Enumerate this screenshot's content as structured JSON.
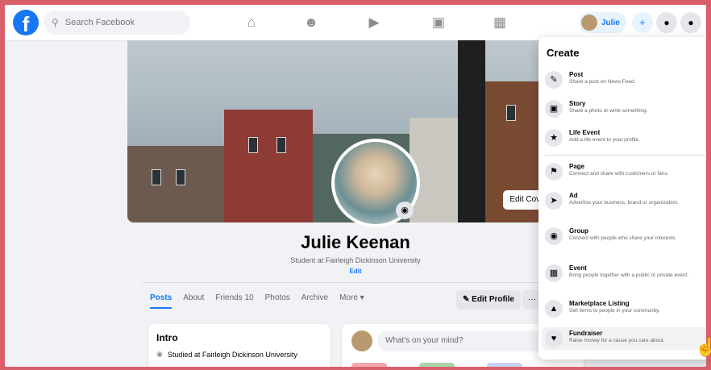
{
  "nav": {
    "search_placeholder": "Search Facebook",
    "profile_name": "Julie"
  },
  "cover": {
    "edit_label": "Edit Cover Photo"
  },
  "profile": {
    "name": "Julie Keenan",
    "bio": "Student at Fairleigh Dickinson University",
    "bio_edit": "Edit"
  },
  "tabs": [
    "Posts",
    "About",
    "Friends 10",
    "Photos",
    "Archive",
    "More ▾"
  ],
  "actions": {
    "edit_profile": "✎ Edit Profile",
    "more": "···"
  },
  "intro": {
    "title": "Intro",
    "line": "Studied at Fairleigh Dickinson University"
  },
  "composer": {
    "placeholder": "What's on your mind?"
  },
  "create_menu": {
    "title": "Create",
    "items": [
      {
        "title": "Post",
        "desc": "Share a post on News Feed."
      },
      {
        "title": "Story",
        "desc": "Share a photo or write something."
      },
      {
        "title": "Life Event",
        "desc": "Add a life event to your profile."
      },
      {
        "title": "Page",
        "desc": "Connect and share with customers or fans."
      },
      {
        "title": "Ad",
        "desc": "Advertise your business, brand or organization."
      },
      {
        "title": "Group",
        "desc": "Connect with people who share your interests."
      },
      {
        "title": "Event",
        "desc": "Bring people together with a public or private event."
      },
      {
        "title": "Marketplace Listing",
        "desc": "Sell items to people in your community."
      },
      {
        "title": "Fundraiser",
        "desc": "Raise money for a cause you care about."
      }
    ]
  },
  "colors": {
    "accent": "#1877f2",
    "background_frame": "#d95f6a"
  }
}
